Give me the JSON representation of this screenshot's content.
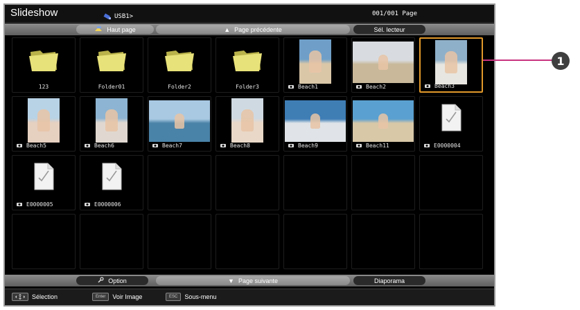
{
  "app_title": "Slideshow",
  "usb_path": "USB1>",
  "page_count": "001/001 Page",
  "top_nav": {
    "home": "Haut page",
    "prev": "Page précédente",
    "reader": "Sél. lecteur"
  },
  "items": [
    {
      "type": "folder",
      "label": "123"
    },
    {
      "type": "folder",
      "label": "Folder01"
    },
    {
      "type": "folder",
      "label": "Folder2"
    },
    {
      "type": "folder",
      "label": "Folder3"
    },
    {
      "type": "photo",
      "label": "Beach1",
      "colors": [
        "#6f9fc8",
        "#d9c7a8"
      ],
      "portrait": true
    },
    {
      "type": "photo",
      "label": "Beach2",
      "colors": [
        "#d8dce0",
        "#c9b89a"
      ],
      "portrait": false
    },
    {
      "type": "photo",
      "label": "Beach3",
      "colors": [
        "#8fb0c9",
        "#e8e6e0"
      ],
      "portrait": true,
      "selected": true
    },
    {
      "type": "photo",
      "label": "Beach5",
      "colors": [
        "#b8d3e6",
        "#e6d0c0"
      ],
      "portrait": true
    },
    {
      "type": "photo",
      "label": "Beach6",
      "colors": [
        "#8db4d2",
        "#e0d8d0"
      ],
      "portrait": true
    },
    {
      "type": "photo",
      "label": "Beach7",
      "colors": [
        "#a9c9e3",
        "#4a83a8"
      ],
      "portrait": false
    },
    {
      "type": "photo",
      "label": "Beach8",
      "colors": [
        "#cfd9e2",
        "#e9d8c8"
      ],
      "portrait": true
    },
    {
      "type": "photo",
      "label": "Beach9",
      "colors": [
        "#3f7db5",
        "#e0e4e8"
      ],
      "portrait": false
    },
    {
      "type": "photo",
      "label": "Beach11",
      "colors": [
        "#5aa0d0",
        "#d8c8a8"
      ],
      "portrait": false
    },
    {
      "type": "jpeg",
      "label": "E0000004"
    },
    {
      "type": "jpeg",
      "label": "E0000005"
    },
    {
      "type": "jpeg",
      "label": "E0000006"
    }
  ],
  "jpeg_badge": "JPEG",
  "bottom_nav": {
    "option": "Option",
    "next": "Page suivante",
    "slideshow": "Diaporama"
  },
  "status": {
    "select": "Sélection",
    "enter_key": "Enter",
    "view": "Voir Image",
    "esc_key": "ESC",
    "submenu": "Sous-menu"
  },
  "callout_number": "1",
  "colors": {
    "selection": "#e39a2b",
    "callout_line": "#c8327f",
    "folder": "#e8e27a"
  }
}
